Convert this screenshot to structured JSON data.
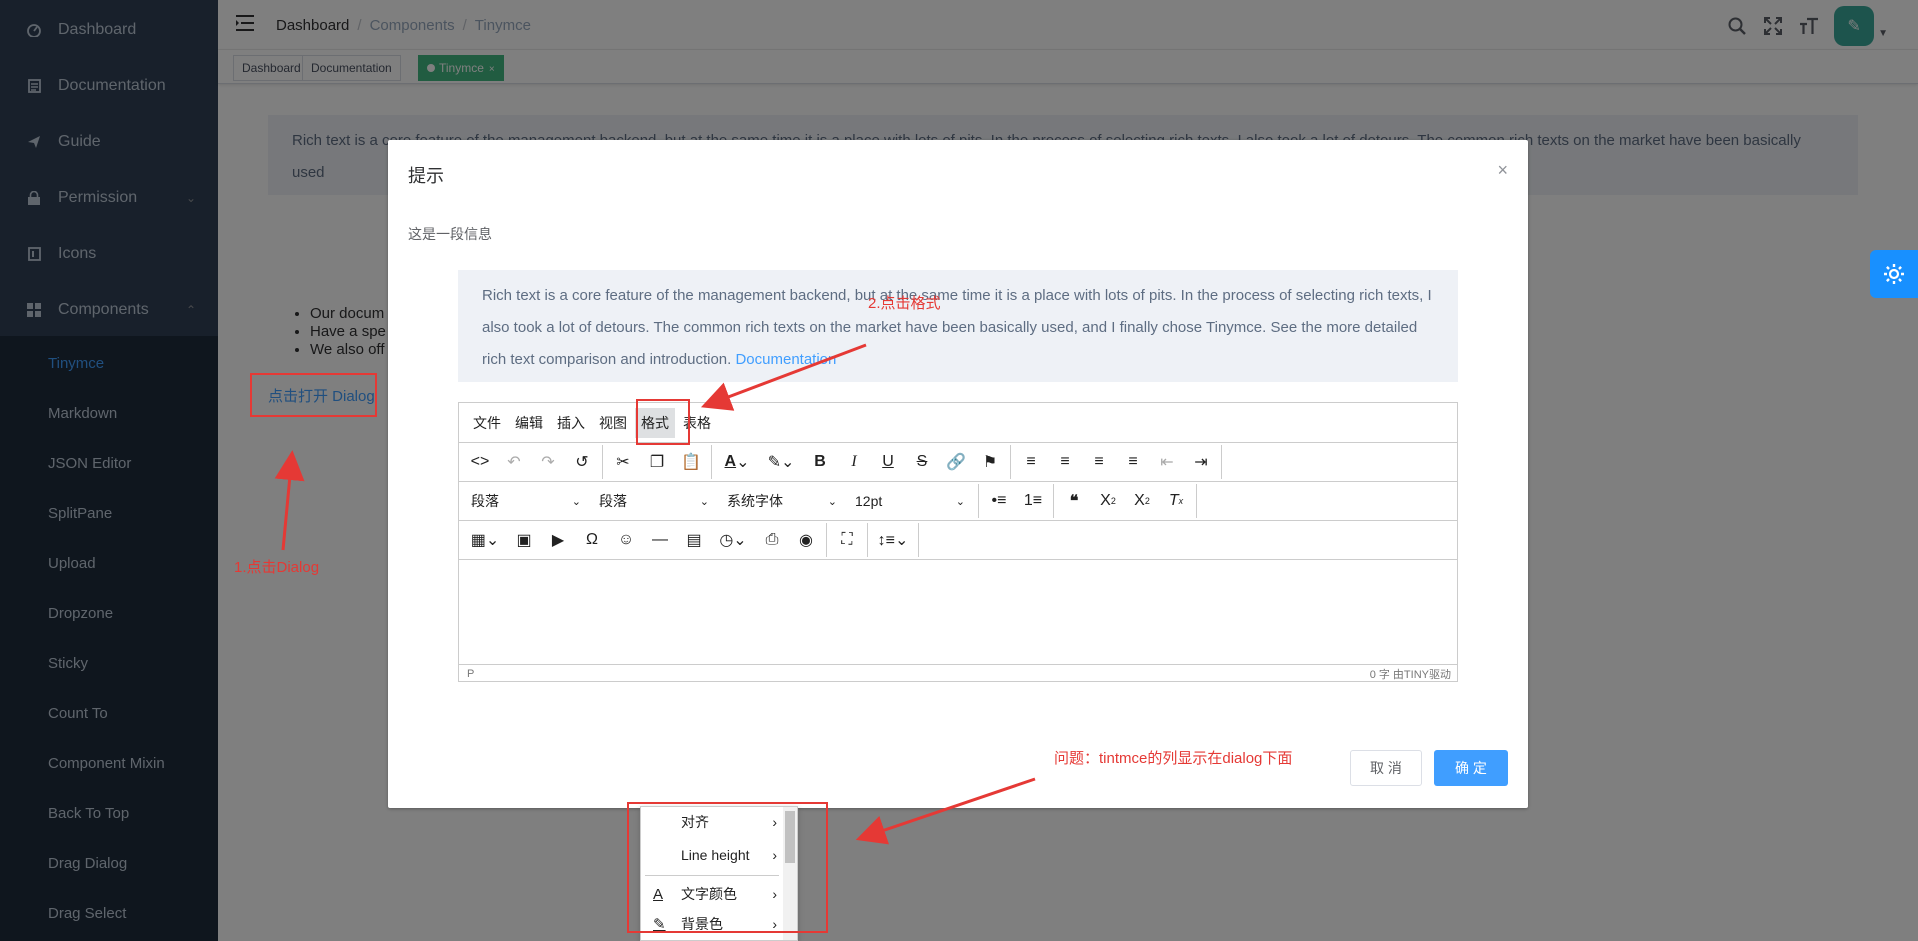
{
  "sidebar": {
    "items": [
      {
        "label": "Dashboard",
        "icon": "dashboard-icon"
      },
      {
        "label": "Documentation",
        "icon": "document-icon"
      },
      {
        "label": "Guide",
        "icon": "guide-icon"
      },
      {
        "label": "Permission",
        "icon": "lock-icon"
      },
      {
        "label": "Icons",
        "icon": "icons-icon"
      },
      {
        "label": "Components",
        "icon": "components-icon"
      }
    ],
    "sub_items": [
      "Tinymce",
      "Markdown",
      "JSON Editor",
      "SplitPane",
      "Upload",
      "Dropzone",
      "Sticky",
      "Count To",
      "Component Mixin",
      "Back To Top",
      "Drag Dialog",
      "Drag Select"
    ],
    "active_sub": "Tinymce"
  },
  "navbar": {
    "breadcrumb": [
      "Dashboard",
      "Components",
      "Tinymce"
    ]
  },
  "tags": {
    "items": [
      "Dashboard",
      "Documentation",
      "Tinymce"
    ],
    "active": "Tinymce",
    "close_glyph": "×"
  },
  "page": {
    "tip_text": "Rich text is a core feature of the management backend, but at the same time it is a place with lots of pits. In the process of selecting rich texts, I also took a lot of detours. The common rich texts on the market have been basically used",
    "list_items": [
      "Our docum",
      "Have a spe",
      "We also off"
    ],
    "open_dialog_link": "点击打开 Dialog"
  },
  "dialog": {
    "title": "提示",
    "close_glyph": "×",
    "message": "这是一段信息",
    "editor_tip": "Rich text is a core feature of the management backend, but at the same time it is a place with lots of pits. In the process of selecting rich texts, I also took a lot of detours. The common rich texts on the market have been basically used, and I finally chose Tinymce. See the more detailed rich text comparison and introduction.",
    "editor_tip_link": "Documentation",
    "cancel_label": "取 消",
    "confirm_label": "确 定"
  },
  "tinymce": {
    "menubar": [
      "文件",
      "编辑",
      "插入",
      "视图",
      "格式",
      "表格"
    ],
    "active_menu": "格式",
    "selects": [
      "段落",
      "段落",
      "系统字体",
      "12pt"
    ],
    "status_left": "P",
    "status_right": "0 字  由TINY驱动"
  },
  "format_menu": {
    "items": [
      "对齐",
      "Line height",
      "文字颜色",
      "背景色"
    ]
  },
  "annotations": {
    "step1": "1.点击Dialog",
    "step2": "2.点击格式",
    "issue": "问题：tintmce的列显示在dialog下面"
  },
  "colors": {
    "sidebar_bg": "#304156",
    "accent": "#409EFF",
    "tag_active": "#42b983",
    "annotation": "#e53935"
  }
}
